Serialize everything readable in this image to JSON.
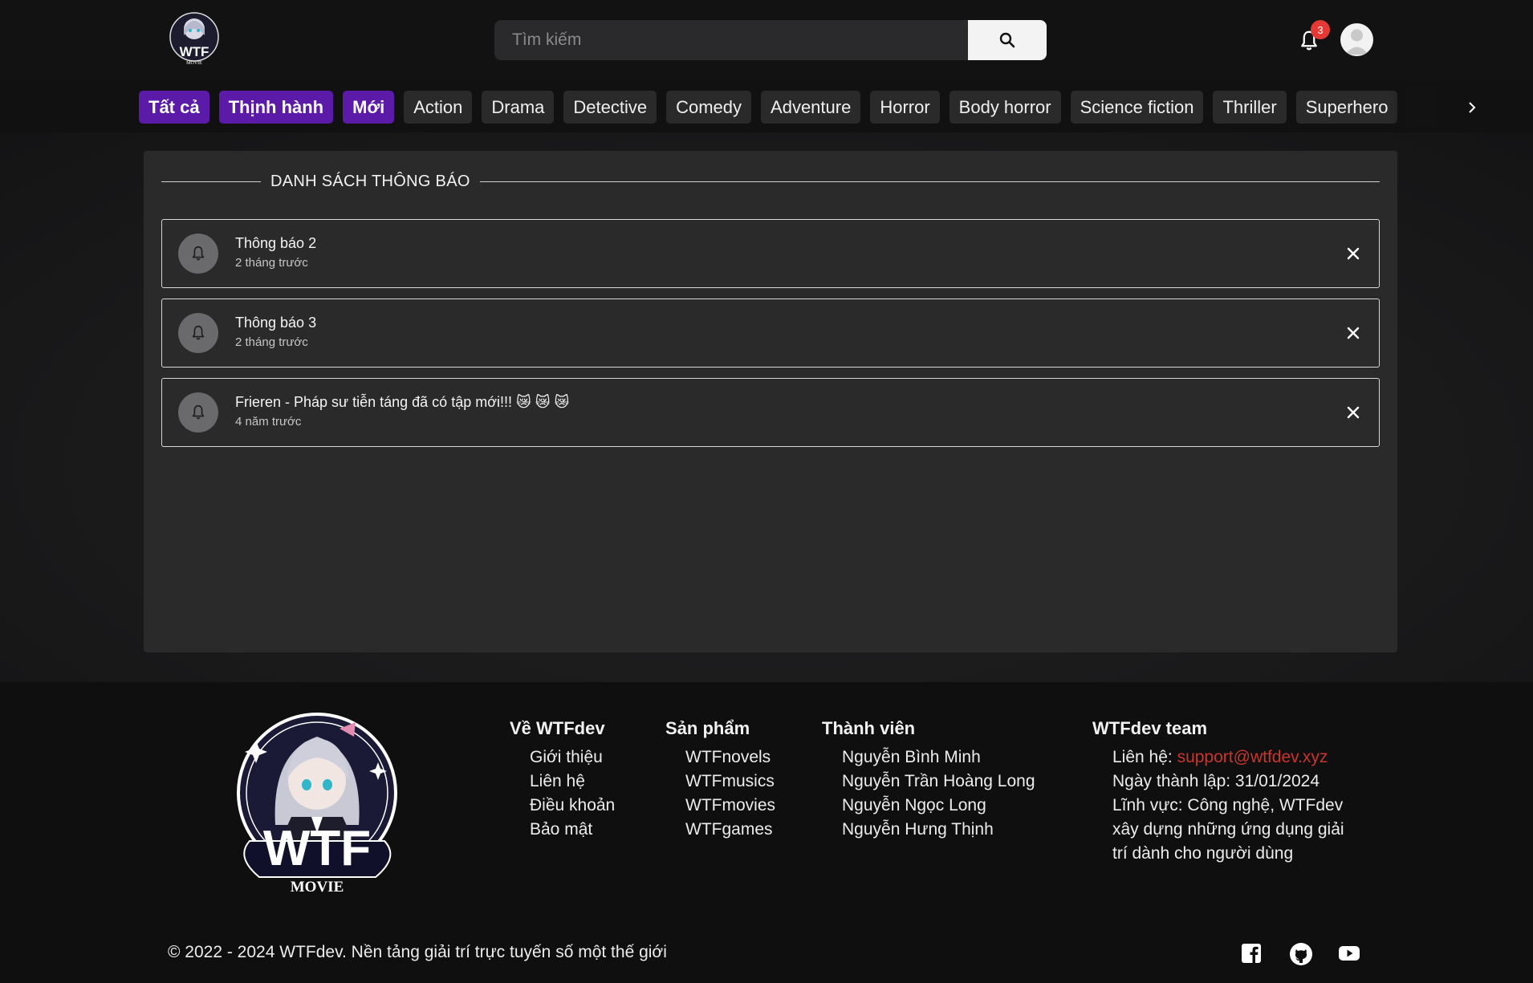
{
  "header": {
    "logo_text": "WTF",
    "logo_sub": "MOVIE",
    "search_placeholder": "Tìm kiếm",
    "notification_count": "3"
  },
  "categories": [
    {
      "label": "Tất cả",
      "primary": true
    },
    {
      "label": "Thịnh hành",
      "primary": true
    },
    {
      "label": "Mới",
      "primary": true
    },
    {
      "label": "Action"
    },
    {
      "label": "Drama"
    },
    {
      "label": "Detective"
    },
    {
      "label": "Comedy"
    },
    {
      "label": "Adventure"
    },
    {
      "label": "Horror"
    },
    {
      "label": "Body horror"
    },
    {
      "label": "Science fiction"
    },
    {
      "label": "Thriller"
    },
    {
      "label": "Superhero"
    }
  ],
  "panel": {
    "title": "DANH SÁCH THÔNG BÁO",
    "notifications": [
      {
        "title": "Thông báo 2",
        "time": "2 tháng trước"
      },
      {
        "title": "Thông báo 3",
        "time": "2 tháng trước"
      },
      {
        "title": "Frieren - Pháp sư tiễn táng đã có tập mới!!! 😿 😿 😿",
        "time": "4 năm trước"
      }
    ]
  },
  "footer": {
    "logo_text": "WTF",
    "logo_sub": "MOVIE",
    "about": {
      "heading": "Về WTFdev",
      "items": [
        "Giới thiệu",
        "Liên hệ",
        "Điều khoản",
        "Bảo mật"
      ]
    },
    "products": {
      "heading": "Sản phẩm",
      "items": [
        "WTFnovels",
        "WTFmusics",
        "WTFmovies",
        "WTFgames"
      ]
    },
    "members": {
      "heading": "Thành viên",
      "items": [
        "Nguyễn Bình Minh",
        "Nguyễn Trần Hoàng Long",
        "Nguyễn Ngọc Long",
        "Nguyễn Hưng Thịnh"
      ]
    },
    "team": {
      "heading": "WTFdev team",
      "contact_label": "Liên hệ: ",
      "contact_email": "support@wtfdev.xyz",
      "founded": "Ngày thành lập: 31/01/2024",
      "field_1": "Lĩnh vực: Công nghệ, WTFdev",
      "field_2": "xây dựng những ứng dụng giải",
      "field_3": "trí dành cho người dùng"
    },
    "copyright": "© 2022 - 2024 WTFdev. Nền tảng giải trí trực tuyến số một thế giới",
    "social_icons": [
      "facebook-icon",
      "github-icon",
      "youtube-icon"
    ]
  },
  "colors": {
    "accent": "#5b1aa8",
    "badge": "#e53935",
    "link": "#c8352e"
  }
}
